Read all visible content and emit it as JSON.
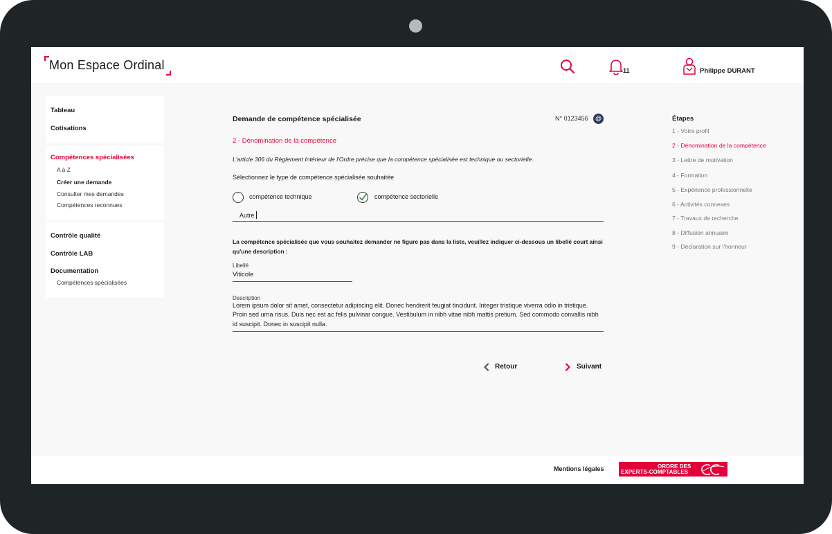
{
  "header": {
    "logo_text": "Mon Espace Ordinal",
    "notification_count": "11",
    "user_name": "Philippe DURANT"
  },
  "sidebar": {
    "items": [
      {
        "label": "Tableau"
      },
      {
        "label": "Cotisations"
      },
      {
        "label": "Compétences spécialisées",
        "active": true
      },
      {
        "label": "A à Z"
      },
      {
        "label": "Créer une demande",
        "current": true
      },
      {
        "label": "Consulter mes demandes"
      },
      {
        "label": "Compétences reconnues"
      },
      {
        "label": "Contrôle qualité"
      },
      {
        "label": "Contrôle LAB"
      },
      {
        "label": "Documentation"
      },
      {
        "label": "Compétences spécialisées"
      }
    ]
  },
  "form": {
    "title": "Demande de compétence spécialisée",
    "request_number": "N° 0123456",
    "section_title": "2 - Dénomination de la compétence",
    "intro": "L'article 306 du Règlement Intérieur de l'Ordre précise que la compétence spécialisée est technique ou sectorielle.",
    "select_label": "Sélectionnez le type de compétence spécialisée souhaitée",
    "radio_technique": "compétence technique",
    "radio_sectorielle": "compétence sectorielle",
    "selected_type": "compétence sectorielle",
    "select_value": "Autre",
    "notice": "La compétence spécialisée que vous souhaitez demander ne figure pas dans la liste, veuillez indiquer ci-dessous un libellé court ainsi qu'une description :",
    "libelle_label": "Libellé",
    "libelle_value": "Viticole",
    "description_label": "Description",
    "description_value": "Lorem ipsum dolor sit amet, consectetur adipiscing elit. Donec hendrerit feugiat tincidunt. Integer tristique viverra odio in tristique. Proin sed urna risus. Duis nec est ac felis pulvinar congue. Vestibulum in nibh vitae nibh mattis pretium. Sed commodo convallis nibh id suscipit. Donec in suscipit nulla.",
    "back_label": "Retour",
    "next_label": "Suivant"
  },
  "steps": {
    "title": "Étapes",
    "items": [
      "1 - Votre profil",
      "2 - Dénomination de la compétence",
      "3 - Lettre de motivation",
      "4 - Formation",
      "5 - Expérience professionnelle",
      "6 - Activités connexes",
      "7 - Travaux de recherche",
      "8 - Diffusion annuaire",
      "9 - Déclaration sur l'honneur"
    ],
    "active_index": 1
  },
  "footer": {
    "legal_link": "Mentions légales",
    "brand_line1": "ORDRE DES",
    "brand_line2": "EXPERTS-COMPTABLES"
  },
  "colors": {
    "accent": "#e4003a",
    "device": "#1f2527",
    "content_bg": "#f9f8f9",
    "success": "#2e8b3a"
  }
}
